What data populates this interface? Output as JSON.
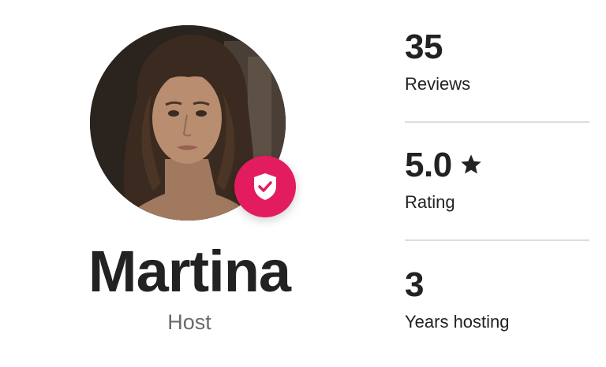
{
  "host": {
    "name": "Martina",
    "role": "Host",
    "avatar_icon": "host-portrait",
    "badge_icon": "verified-shield-check-icon",
    "badge_color": "#e31c5f"
  },
  "stats": {
    "reviews": {
      "value": "35",
      "label": "Reviews"
    },
    "rating": {
      "value": "5.0",
      "label": "Rating",
      "icon": "star-icon"
    },
    "years": {
      "value": "3",
      "label": "Years hosting"
    }
  },
  "colors": {
    "text": "#222222",
    "muted": "#6a6a6a",
    "divider": "#dddddd",
    "accent": "#e31c5f"
  }
}
